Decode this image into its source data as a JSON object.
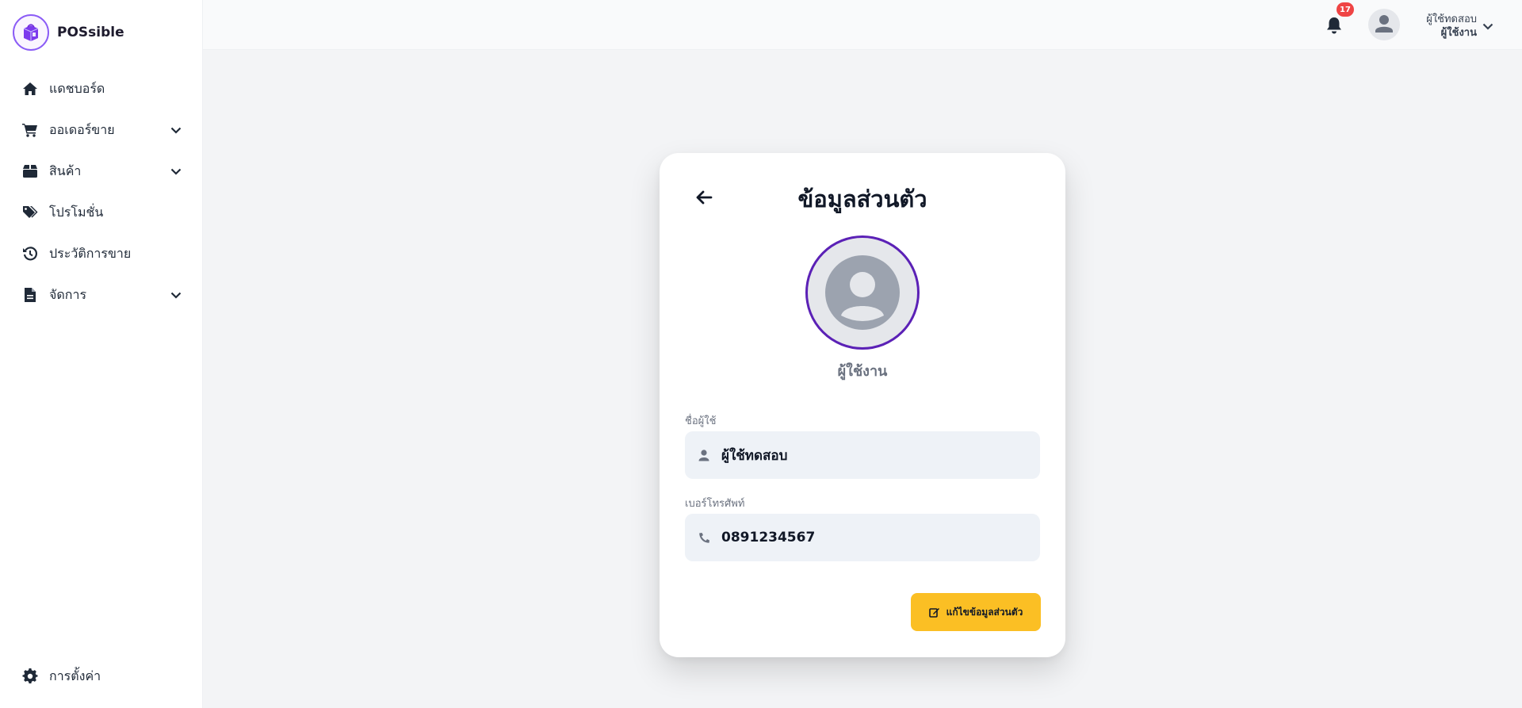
{
  "app": {
    "brand_name": "POSsible",
    "accent": "#5b21b6",
    "button_color": "#fbbf24"
  },
  "sidebar": {
    "items": [
      {
        "label": "แดชบอร์ด",
        "icon": "home-icon",
        "expandable": false
      },
      {
        "label": "ออเดอร์ขาย",
        "icon": "cart-icon",
        "expandable": true
      },
      {
        "label": "สินค้า",
        "icon": "box-icon",
        "expandable": true
      },
      {
        "label": "โปรโมชั่น",
        "icon": "tags-icon",
        "expandable": false
      },
      {
        "label": "ประวัติการขาย",
        "icon": "history-icon",
        "expandable": false
      },
      {
        "label": "จัดการ",
        "icon": "file-icon",
        "expandable": true
      }
    ],
    "bottom": {
      "label": "การตั้งค่า",
      "icon": "gear-icon"
    }
  },
  "topbar": {
    "notification_count": "17",
    "user_name": "ผู้ใช้ทดสอบ",
    "user_role": "ผู้ใช้งาน"
  },
  "profile": {
    "title": "ข้อมูลส่วนตัว",
    "role": "ผู้ใช้งาน",
    "username_label": "ชื่อผู้ใช้",
    "username_value": "ผู้ใช้ทดสอบ",
    "phone_label": "เบอร์โทรศัพท์",
    "phone_value": "0891234567",
    "edit_button": "แก้ไขข้อมูลส่วนตัว"
  }
}
